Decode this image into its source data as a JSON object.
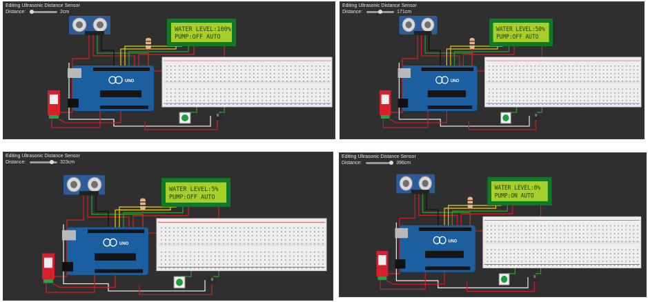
{
  "panels": [
    {
      "title": "Editing Ultrasonic Distance Sensor",
      "distance_label": "Distance:",
      "distance_value": "2cm",
      "slider_fraction": 0.0,
      "lcd_line1": "WATER LEVEL:100%",
      "lcd_line2": "PUMP:OFF AUTO"
    },
    {
      "title": "Editing Ultrasonic Distance Sensor",
      "distance_label": "Distance:",
      "distance_value": "171cm",
      "slider_fraction": 0.5,
      "lcd_line1": "WATER LEVEL:50%",
      "lcd_line2": "PUMP:OFF AUTO"
    },
    {
      "title": "Editing Ultrasonic Distance Sensor",
      "distance_label": "Distance:",
      "distance_value": "323cm",
      "slider_fraction": 0.85,
      "lcd_line1": "WATER LEVEL:5%",
      "lcd_line2": "PUMP:OFF AUTO"
    },
    {
      "title": "Editing Ultrasonic Distance Sensor",
      "distance_label": "Distance:",
      "distance_value": "396cm",
      "slider_fraction": 1.0,
      "lcd_line1": "WATER LEVEL:0%",
      "lcd_line2": "PUMP:ON  AUTO"
    }
  ],
  "board": {
    "brand": "UNO"
  },
  "colors": {
    "workspace": "#2f2f2f",
    "lcd_frame": "#0f7a25",
    "lcd_screen": "#a6cf2a",
    "arduino": "#1b5fa0",
    "breadboard": "#eeeeee",
    "sensor": "#2b5b99",
    "relay": "#d7202b",
    "button": "#1e9e3a",
    "wire_red": "#c8202a",
    "wire_green": "#2e9a2e",
    "wire_yellow": "#e0c020",
    "wire_white": "#e8e8e8",
    "wire_black": "#111111"
  },
  "icons": [
    "ultrasonic-sensor-icon",
    "lcd-display-icon",
    "arduino-board-icon",
    "breadboard-icon",
    "relay-module-icon",
    "push-button-icon",
    "slide-switch-icon",
    "resistor-icon"
  ]
}
